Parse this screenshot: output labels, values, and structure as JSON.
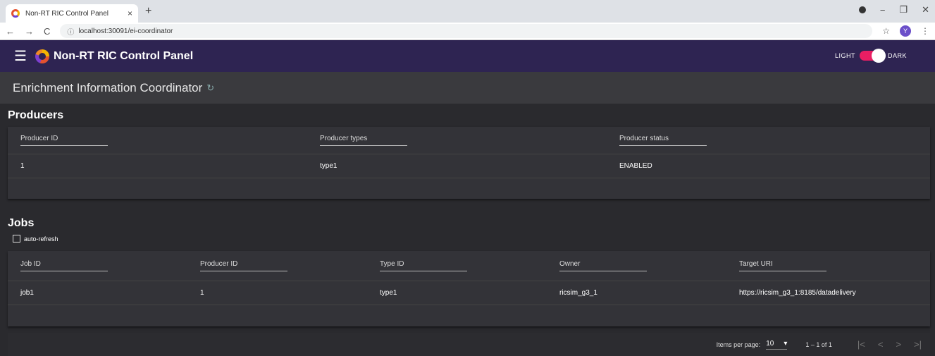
{
  "browser": {
    "tab_title": "Non-RT RIC Control Panel",
    "tab_close": "×",
    "new_tab": "+",
    "back": "←",
    "forward": "→",
    "reload": "C",
    "url": "localhost:30091/ei-coordinator",
    "bookmark": "☆",
    "profile_letter": "Y",
    "menu": "⋮",
    "win_min": "−",
    "win_max": "❐",
    "win_close": "✕"
  },
  "toolbar": {
    "menu_icon": "☰",
    "title": "Non-RT RIC Control Panel",
    "light_label": "LIGHT",
    "dark_label": "DARK",
    "accent_color": "#e91e63",
    "bar_color": "#2e2452"
  },
  "page": {
    "title": "Enrichment Information Coordinator",
    "refresh_icon": "↻"
  },
  "producers": {
    "title": "Producers",
    "columns": [
      "Producer ID",
      "Producer types",
      "Producer status"
    ],
    "rows": [
      [
        "1",
        "type1",
        "ENABLED"
      ]
    ]
  },
  "jobs": {
    "title": "Jobs",
    "auto_refresh_label": "auto-refresh",
    "columns": [
      "Job ID",
      "Producer ID",
      "Type ID",
      "Owner",
      "Target URI"
    ],
    "rows": [
      [
        "job1",
        "1",
        "type1",
        "ricsim_g3_1",
        "https://ricsim_g3_1:8185/datadelivery"
      ]
    ]
  },
  "paginator": {
    "items_per_page_label": "Items per page:",
    "items_per_page": "10",
    "range": "1 – 1 of 1",
    "first": "|<",
    "prev": "<",
    "next": ">",
    "last": ">|"
  }
}
